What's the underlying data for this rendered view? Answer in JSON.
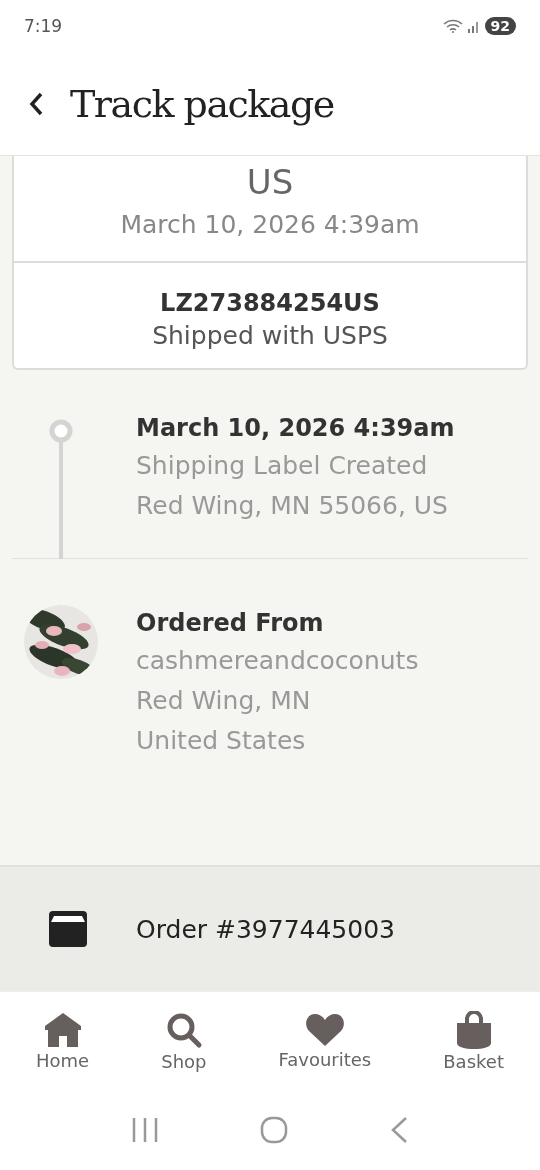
{
  "status_bar": {
    "time": "7:19",
    "battery": "92"
  },
  "header": {
    "title": "Track package"
  },
  "shipment_card": {
    "location_tail": "US",
    "timestamp": "March 10, 2026 4:39am",
    "tracking_number": "LZ273884254US",
    "carrier": "Shipped with USPS"
  },
  "timeline": [
    {
      "kind": "event",
      "title": "March 10, 2026 4:39am",
      "lines": [
        "Shipping Label Created",
        "Red Wing, MN 55066, US"
      ]
    },
    {
      "kind": "origin",
      "title": "Ordered From",
      "lines": [
        "cashmereandcoconuts",
        "Red Wing, MN",
        "United States"
      ]
    }
  ],
  "order": {
    "label": "Order #3977445003"
  },
  "bottom_nav": [
    {
      "label": "Home",
      "kind": "home"
    },
    {
      "label": "Shop",
      "kind": "search"
    },
    {
      "label": "Favourites",
      "kind": "heart"
    },
    {
      "label": "Basket",
      "kind": "bag"
    }
  ]
}
